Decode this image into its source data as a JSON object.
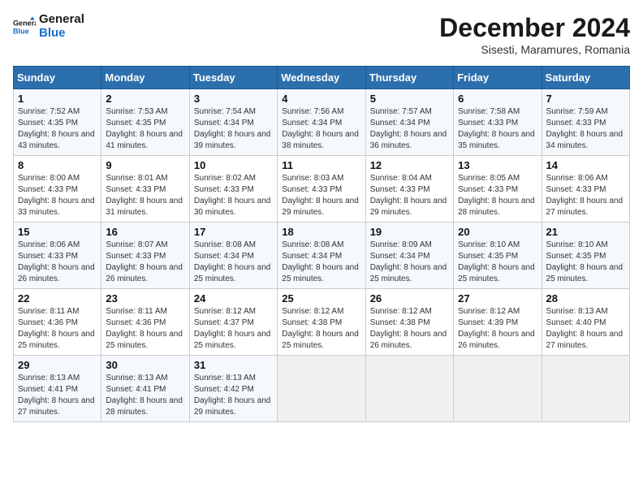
{
  "logo": {
    "line1": "General",
    "line2": "Blue"
  },
  "title": "December 2024",
  "subtitle": "Sisesti, Maramures, Romania",
  "days_of_week": [
    "Sunday",
    "Monday",
    "Tuesday",
    "Wednesday",
    "Thursday",
    "Friday",
    "Saturday"
  ],
  "weeks": [
    [
      {
        "day": "1",
        "sunrise": "7:52 AM",
        "sunset": "4:35 PM",
        "daylight": "8 hours and 43 minutes."
      },
      {
        "day": "2",
        "sunrise": "7:53 AM",
        "sunset": "4:35 PM",
        "daylight": "8 hours and 41 minutes."
      },
      {
        "day": "3",
        "sunrise": "7:54 AM",
        "sunset": "4:34 PM",
        "daylight": "8 hours and 39 minutes."
      },
      {
        "day": "4",
        "sunrise": "7:56 AM",
        "sunset": "4:34 PM",
        "daylight": "8 hours and 38 minutes."
      },
      {
        "day": "5",
        "sunrise": "7:57 AM",
        "sunset": "4:34 PM",
        "daylight": "8 hours and 36 minutes."
      },
      {
        "day": "6",
        "sunrise": "7:58 AM",
        "sunset": "4:33 PM",
        "daylight": "8 hours and 35 minutes."
      },
      {
        "day": "7",
        "sunrise": "7:59 AM",
        "sunset": "4:33 PM",
        "daylight": "8 hours and 34 minutes."
      }
    ],
    [
      {
        "day": "8",
        "sunrise": "8:00 AM",
        "sunset": "4:33 PM",
        "daylight": "8 hours and 33 minutes."
      },
      {
        "day": "9",
        "sunrise": "8:01 AM",
        "sunset": "4:33 PM",
        "daylight": "8 hours and 31 minutes."
      },
      {
        "day": "10",
        "sunrise": "8:02 AM",
        "sunset": "4:33 PM",
        "daylight": "8 hours and 30 minutes."
      },
      {
        "day": "11",
        "sunrise": "8:03 AM",
        "sunset": "4:33 PM",
        "daylight": "8 hours and 29 minutes."
      },
      {
        "day": "12",
        "sunrise": "8:04 AM",
        "sunset": "4:33 PM",
        "daylight": "8 hours and 29 minutes."
      },
      {
        "day": "13",
        "sunrise": "8:05 AM",
        "sunset": "4:33 PM",
        "daylight": "8 hours and 28 minutes."
      },
      {
        "day": "14",
        "sunrise": "8:06 AM",
        "sunset": "4:33 PM",
        "daylight": "8 hours and 27 minutes."
      }
    ],
    [
      {
        "day": "15",
        "sunrise": "8:06 AM",
        "sunset": "4:33 PM",
        "daylight": "8 hours and 26 minutes."
      },
      {
        "day": "16",
        "sunrise": "8:07 AM",
        "sunset": "4:33 PM",
        "daylight": "8 hours and 26 minutes."
      },
      {
        "day": "17",
        "sunrise": "8:08 AM",
        "sunset": "4:34 PM",
        "daylight": "8 hours and 25 minutes."
      },
      {
        "day": "18",
        "sunrise": "8:08 AM",
        "sunset": "4:34 PM",
        "daylight": "8 hours and 25 minutes."
      },
      {
        "day": "19",
        "sunrise": "8:09 AM",
        "sunset": "4:34 PM",
        "daylight": "8 hours and 25 minutes."
      },
      {
        "day": "20",
        "sunrise": "8:10 AM",
        "sunset": "4:35 PM",
        "daylight": "8 hours and 25 minutes."
      },
      {
        "day": "21",
        "sunrise": "8:10 AM",
        "sunset": "4:35 PM",
        "daylight": "8 hours and 25 minutes."
      }
    ],
    [
      {
        "day": "22",
        "sunrise": "8:11 AM",
        "sunset": "4:36 PM",
        "daylight": "8 hours and 25 minutes."
      },
      {
        "day": "23",
        "sunrise": "8:11 AM",
        "sunset": "4:36 PM",
        "daylight": "8 hours and 25 minutes."
      },
      {
        "day": "24",
        "sunrise": "8:12 AM",
        "sunset": "4:37 PM",
        "daylight": "8 hours and 25 minutes."
      },
      {
        "day": "25",
        "sunrise": "8:12 AM",
        "sunset": "4:38 PM",
        "daylight": "8 hours and 25 minutes."
      },
      {
        "day": "26",
        "sunrise": "8:12 AM",
        "sunset": "4:38 PM",
        "daylight": "8 hours and 26 minutes."
      },
      {
        "day": "27",
        "sunrise": "8:12 AM",
        "sunset": "4:39 PM",
        "daylight": "8 hours and 26 minutes."
      },
      {
        "day": "28",
        "sunrise": "8:13 AM",
        "sunset": "4:40 PM",
        "daylight": "8 hours and 27 minutes."
      }
    ],
    [
      {
        "day": "29",
        "sunrise": "8:13 AM",
        "sunset": "4:41 PM",
        "daylight": "8 hours and 27 minutes."
      },
      {
        "day": "30",
        "sunrise": "8:13 AM",
        "sunset": "4:41 PM",
        "daylight": "8 hours and 28 minutes."
      },
      {
        "day": "31",
        "sunrise": "8:13 AM",
        "sunset": "4:42 PM",
        "daylight": "8 hours and 29 minutes."
      },
      null,
      null,
      null,
      null
    ]
  ]
}
